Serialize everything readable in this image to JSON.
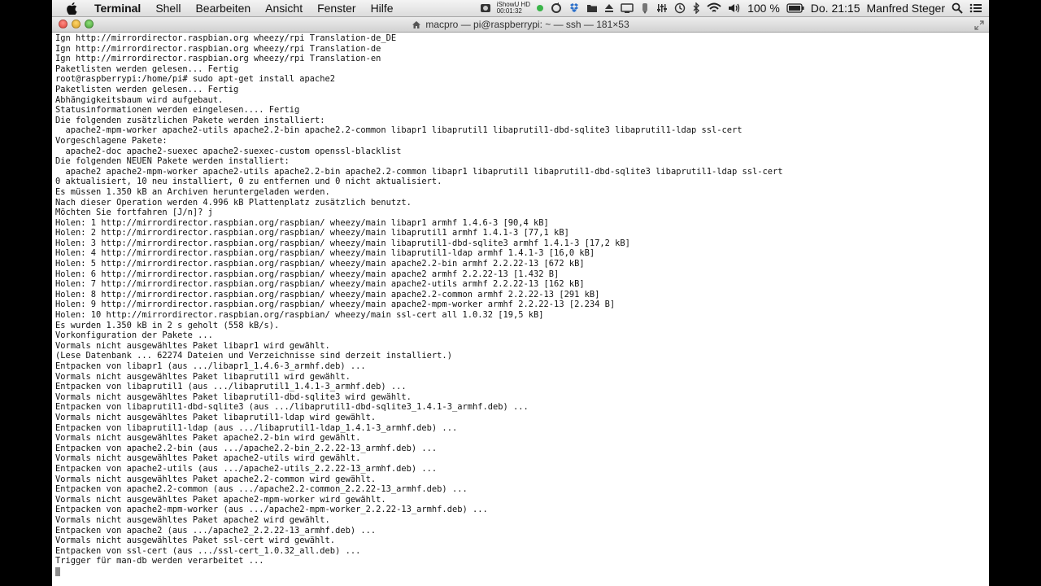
{
  "menubar": {
    "app_name": "Terminal",
    "items": [
      "Shell",
      "Bearbeiten",
      "Ansicht",
      "Fenster",
      "Hilfe"
    ],
    "recorder": {
      "title": "iShowU HD",
      "time": "00:01:32"
    },
    "battery": "100 %",
    "clock": "Do. 21:15",
    "user": "Manfred Steger"
  },
  "window": {
    "title": "macpro — pi@raspberrypi: ~ — ssh — 181×53"
  },
  "terminal": {
    "lines": [
      "Ign http://mirrordirector.raspbian.org wheezy/rpi Translation-de_DE",
      "Ign http://mirrordirector.raspbian.org wheezy/rpi Translation-de",
      "Ign http://mirrordirector.raspbian.org wheezy/rpi Translation-en",
      "Paketlisten werden gelesen... Fertig",
      "root@raspberrypi:/home/pi# sudo apt-get install apache2",
      "Paketlisten werden gelesen... Fertig",
      "Abhängigkeitsbaum wird aufgebaut.",
      "Statusinformationen werden eingelesen.... Fertig",
      "Die folgenden zusätzlichen Pakete werden installiert:",
      "  apache2-mpm-worker apache2-utils apache2.2-bin apache2.2-common libapr1 libaprutil1 libaprutil1-dbd-sqlite3 libaprutil1-ldap ssl-cert",
      "Vorgeschlagene Pakete:",
      "  apache2-doc apache2-suexec apache2-suexec-custom openssl-blacklist",
      "Die folgenden NEUEN Pakete werden installiert:",
      "  apache2 apache2-mpm-worker apache2-utils apache2.2-bin apache2.2-common libapr1 libaprutil1 libaprutil1-dbd-sqlite3 libaprutil1-ldap ssl-cert",
      "0 aktualisiert, 10 neu installiert, 0 zu entfernen und 0 nicht aktualisiert.",
      "Es müssen 1.350 kB an Archiven heruntergeladen werden.",
      "Nach dieser Operation werden 4.996 kB Plattenplatz zusätzlich benutzt.",
      "Möchten Sie fortfahren [J/n]? j",
      "Holen: 1 http://mirrordirector.raspbian.org/raspbian/ wheezy/main libapr1 armhf 1.4.6-3 [90,4 kB]",
      "Holen: 2 http://mirrordirector.raspbian.org/raspbian/ wheezy/main libaprutil1 armhf 1.4.1-3 [77,1 kB]",
      "Holen: 3 http://mirrordirector.raspbian.org/raspbian/ wheezy/main libaprutil1-dbd-sqlite3 armhf 1.4.1-3 [17,2 kB]",
      "Holen: 4 http://mirrordirector.raspbian.org/raspbian/ wheezy/main libaprutil1-ldap armhf 1.4.1-3 [16,0 kB]",
      "Holen: 5 http://mirrordirector.raspbian.org/raspbian/ wheezy/main apache2.2-bin armhf 2.2.22-13 [672 kB]",
      "Holen: 6 http://mirrordirector.raspbian.org/raspbian/ wheezy/main apache2 armhf 2.2.22-13 [1.432 B]",
      "Holen: 7 http://mirrordirector.raspbian.org/raspbian/ wheezy/main apache2-utils armhf 2.2.22-13 [162 kB]",
      "Holen: 8 http://mirrordirector.raspbian.org/raspbian/ wheezy/main apache2.2-common armhf 2.2.22-13 [291 kB]",
      "Holen: 9 http://mirrordirector.raspbian.org/raspbian/ wheezy/main apache2-mpm-worker armhf 2.2.22-13 [2.234 B]",
      "Holen: 10 http://mirrordirector.raspbian.org/raspbian/ wheezy/main ssl-cert all 1.0.32 [19,5 kB]",
      "Es wurden 1.350 kB in 2 s geholt (558 kB/s).",
      "Vorkonfiguration der Pakete ...",
      "Vormals nicht ausgewähltes Paket libapr1 wird gewählt.",
      "(Lese Datenbank ... 62274 Dateien und Verzeichnisse sind derzeit installiert.)",
      "Entpacken von libapr1 (aus .../libapr1_1.4.6-3_armhf.deb) ...",
      "Vormals nicht ausgewähltes Paket libaprutil1 wird gewählt.",
      "Entpacken von libaprutil1 (aus .../libaprutil1_1.4.1-3_armhf.deb) ...",
      "Vormals nicht ausgewähltes Paket libaprutil1-dbd-sqlite3 wird gewählt.",
      "Entpacken von libaprutil1-dbd-sqlite3 (aus .../libaprutil1-dbd-sqlite3_1.4.1-3_armhf.deb) ...",
      "Vormals nicht ausgewähltes Paket libaprutil1-ldap wird gewählt.",
      "Entpacken von libaprutil1-ldap (aus .../libaprutil1-ldap_1.4.1-3_armhf.deb) ...",
      "Vormals nicht ausgewähltes Paket apache2.2-bin wird gewählt.",
      "Entpacken von apache2.2-bin (aus .../apache2.2-bin_2.2.22-13_armhf.deb) ...",
      "Vormals nicht ausgewähltes Paket apache2-utils wird gewählt.",
      "Entpacken von apache2-utils (aus .../apache2-utils_2.2.22-13_armhf.deb) ...",
      "Vormals nicht ausgewähltes Paket apache2.2-common wird gewählt.",
      "Entpacken von apache2.2-common (aus .../apache2.2-common_2.2.22-13_armhf.deb) ...",
      "Vormals nicht ausgewähltes Paket apache2-mpm-worker wird gewählt.",
      "Entpacken von apache2-mpm-worker (aus .../apache2-mpm-worker_2.2.22-13_armhf.deb) ...",
      "Vormals nicht ausgewähltes Paket apache2 wird gewählt.",
      "Entpacken von apache2 (aus .../apache2_2.2.22-13_armhf.deb) ...",
      "Vormals nicht ausgewähltes Paket ssl-cert wird gewählt.",
      "Entpacken von ssl-cert (aus .../ssl-cert_1.0.32_all.deb) ...",
      "Trigger für man-db werden verarbeitet ..."
    ]
  }
}
